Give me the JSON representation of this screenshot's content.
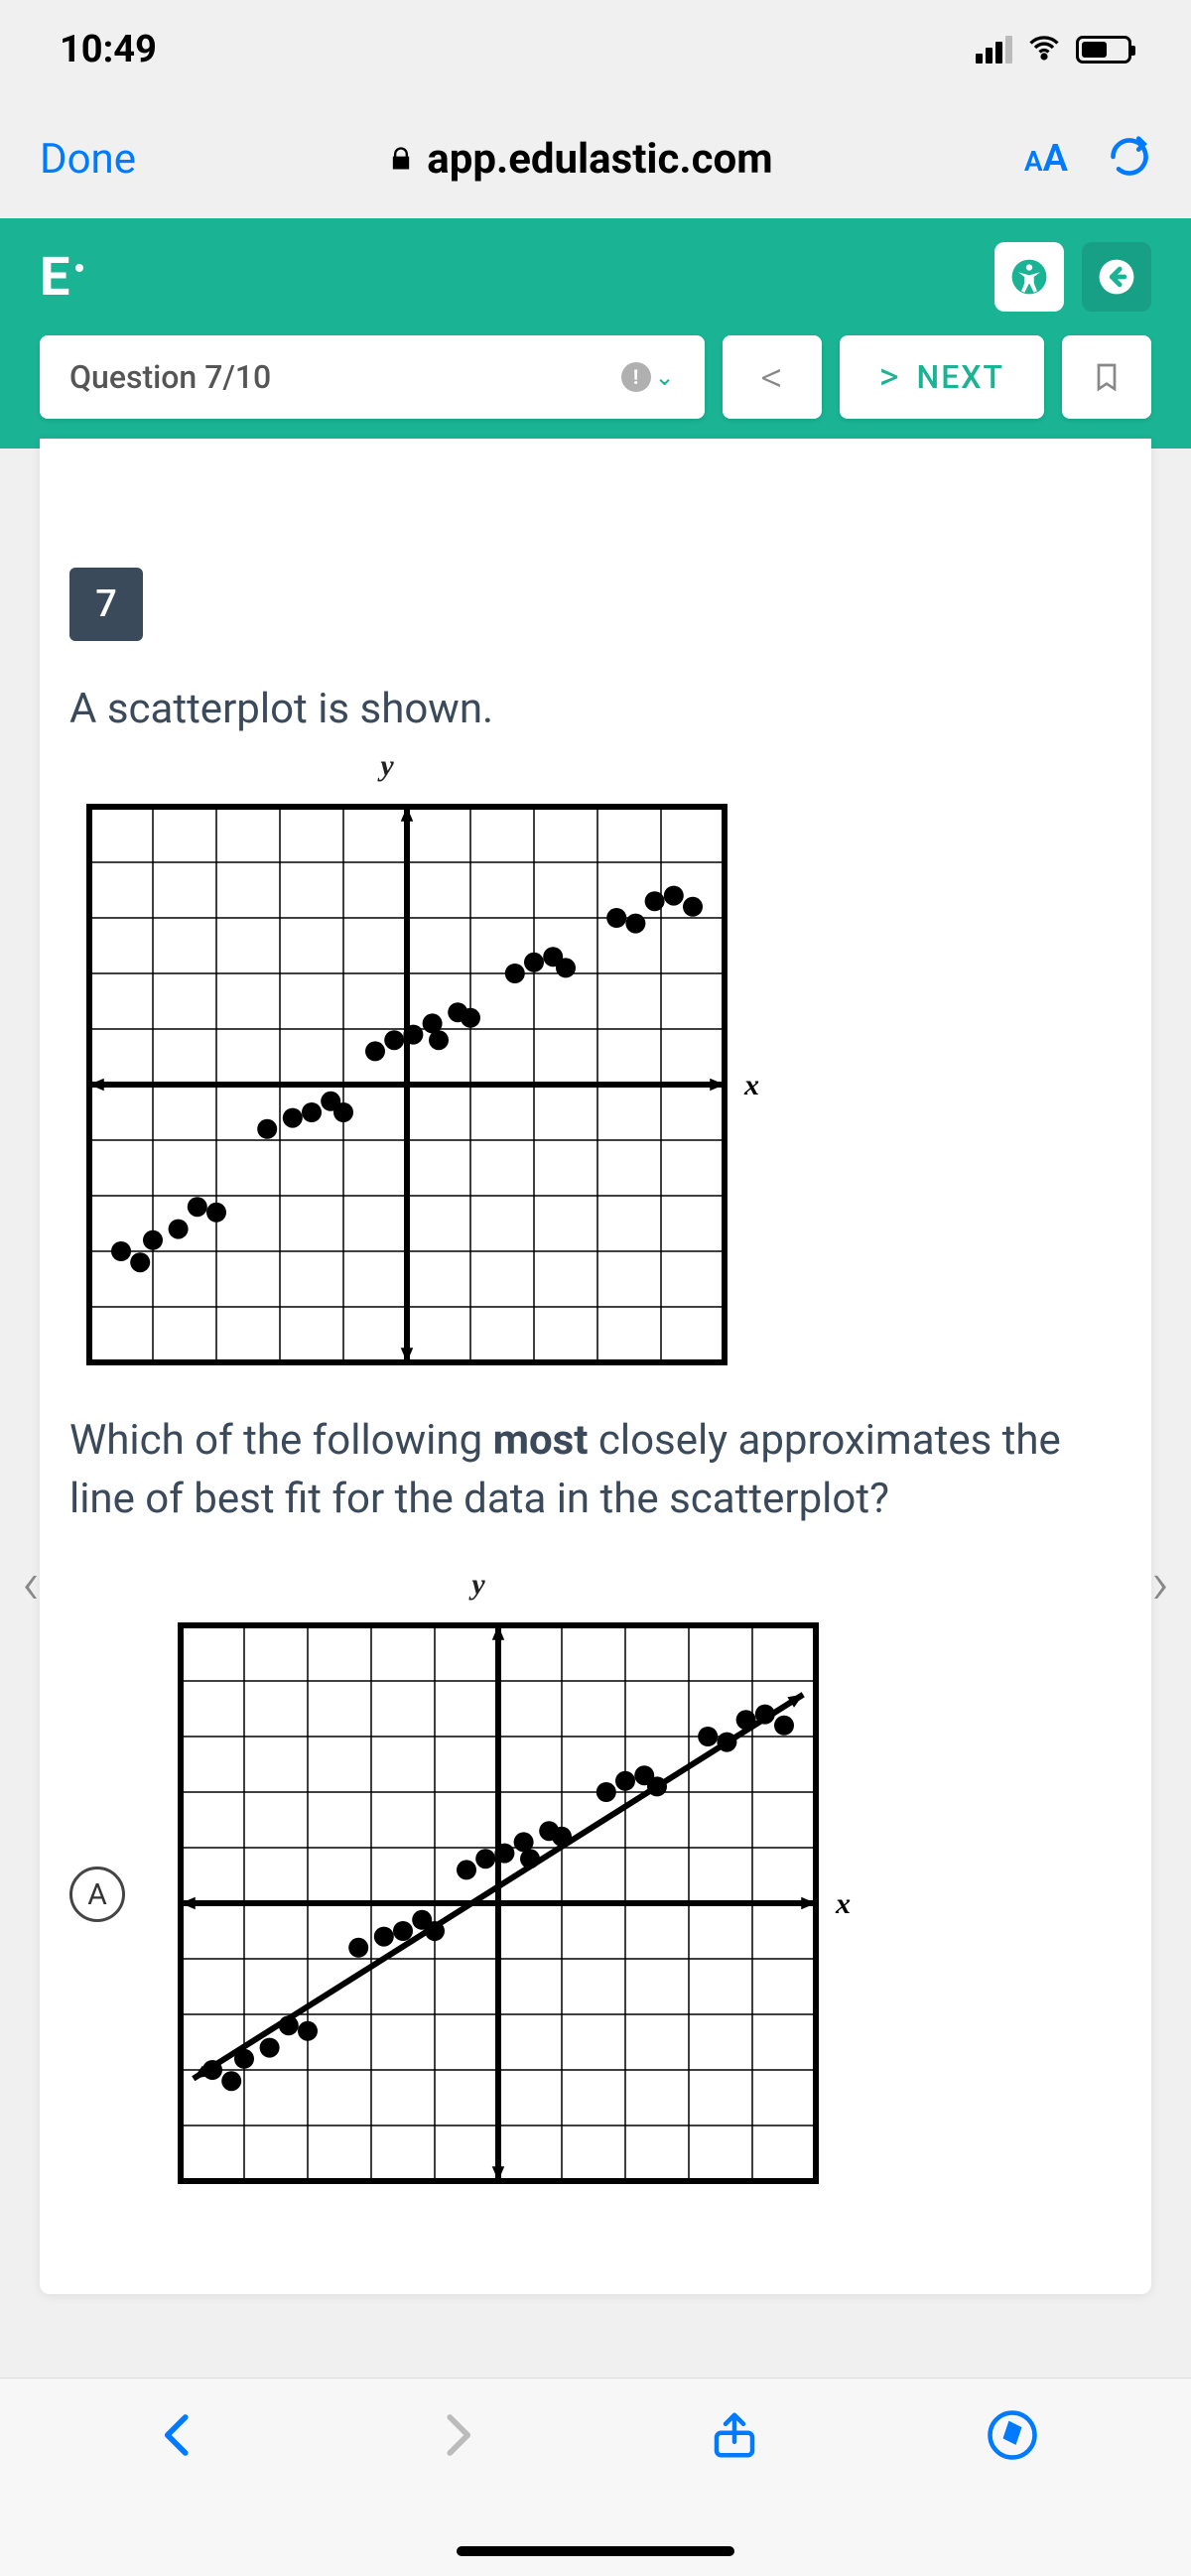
{
  "status": {
    "time": "10:49"
  },
  "browser": {
    "done": "Done",
    "url": "app.edulastic.com",
    "aa": "A"
  },
  "app": {
    "logo": "E"
  },
  "nav": {
    "question_label": "Question 7/10",
    "next": "NEXT"
  },
  "question": {
    "number": "7",
    "prompt": "A scatterplot is shown.",
    "y_label": "y",
    "x_label": "x",
    "body_pre": "Which of the following ",
    "body_bold": "most",
    "body_post": " closely approximates the line of best fit for the data in the scatterplot?"
  },
  "option": {
    "letter": "A",
    "y_label": "y",
    "x_label": "x"
  },
  "chart_data": [
    {
      "type": "scatter",
      "title": "scatterplot-question",
      "xlabel": "x",
      "ylabel": "y",
      "xlim": [
        -5,
        5
      ],
      "ylim": [
        -5,
        5
      ],
      "series": [
        {
          "name": "data",
          "points": [
            [
              -4.5,
              -3.0
            ],
            [
              -4.2,
              -3.2
            ],
            [
              -4.0,
              -2.8
            ],
            [
              -3.6,
              -2.6
            ],
            [
              -3.3,
              -2.2
            ],
            [
              -3.0,
              -2.3
            ],
            [
              -2.2,
              -0.8
            ],
            [
              -1.8,
              -0.6
            ],
            [
              -1.5,
              -0.5
            ],
            [
              -1.2,
              -0.3
            ],
            [
              -1.0,
              -0.5
            ],
            [
              -0.5,
              0.6
            ],
            [
              -0.2,
              0.8
            ],
            [
              0.1,
              0.9
            ],
            [
              0.4,
              1.1
            ],
            [
              0.5,
              0.8
            ],
            [
              0.8,
              1.3
            ],
            [
              1.0,
              1.2
            ],
            [
              1.7,
              2.0
            ],
            [
              2.0,
              2.2
            ],
            [
              2.3,
              2.3
            ],
            [
              2.5,
              2.1
            ],
            [
              3.3,
              3.0
            ],
            [
              3.6,
              2.9
            ],
            [
              3.9,
              3.3
            ],
            [
              4.2,
              3.4
            ],
            [
              4.5,
              3.2
            ]
          ]
        }
      ]
    },
    {
      "type": "scatter",
      "title": "option-A",
      "xlabel": "x",
      "ylabel": "y",
      "xlim": [
        -5,
        5
      ],
      "ylim": [
        -5,
        5
      ],
      "line": {
        "slope": 0.72,
        "intercept": 0.3
      },
      "series": [
        {
          "name": "data",
          "points": [
            [
              -4.5,
              -3.0
            ],
            [
              -4.2,
              -3.2
            ],
            [
              -4.0,
              -2.8
            ],
            [
              -3.6,
              -2.6
            ],
            [
              -3.3,
              -2.2
            ],
            [
              -3.0,
              -2.3
            ],
            [
              -2.2,
              -0.8
            ],
            [
              -1.8,
              -0.6
            ],
            [
              -1.5,
              -0.5
            ],
            [
              -1.2,
              -0.3
            ],
            [
              -1.0,
              -0.5
            ],
            [
              -0.5,
              0.6
            ],
            [
              -0.2,
              0.8
            ],
            [
              0.1,
              0.9
            ],
            [
              0.4,
              1.1
            ],
            [
              0.5,
              0.8
            ],
            [
              0.8,
              1.3
            ],
            [
              1.0,
              1.2
            ],
            [
              1.7,
              2.0
            ],
            [
              2.0,
              2.2
            ],
            [
              2.3,
              2.3
            ],
            [
              2.5,
              2.1
            ],
            [
              3.3,
              3.0
            ],
            [
              3.6,
              2.9
            ],
            [
              3.9,
              3.3
            ],
            [
              4.2,
              3.4
            ],
            [
              4.5,
              3.2
            ]
          ]
        }
      ]
    }
  ]
}
